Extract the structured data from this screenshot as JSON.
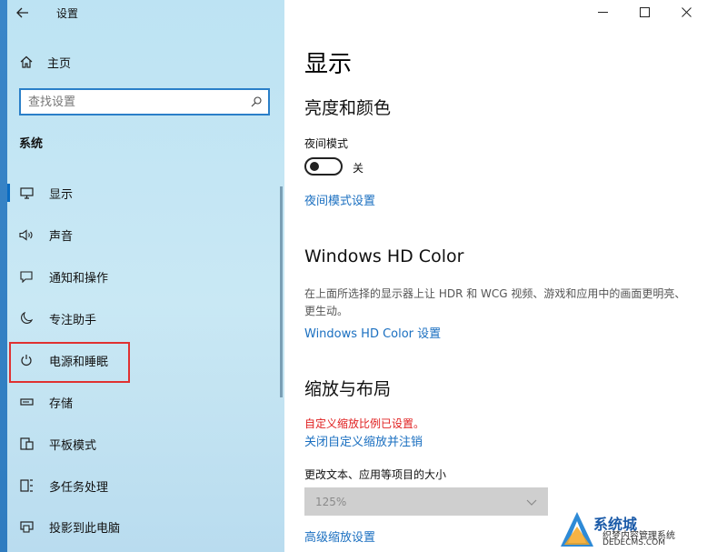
{
  "window": {
    "app_title": "设置",
    "back_icon": "arrow-left-icon",
    "controls": {
      "minimize": "—",
      "maximize": "☐",
      "close": "✕"
    }
  },
  "sidebar": {
    "home_label": "主页",
    "search_placeholder": "查找设置",
    "section_title": "系统",
    "items": [
      {
        "icon": "monitor-icon",
        "label": "显示",
        "active": true
      },
      {
        "icon": "speaker-icon",
        "label": "声音"
      },
      {
        "icon": "notification-icon",
        "label": "通知和操作"
      },
      {
        "icon": "moon-icon",
        "label": "专注助手"
      },
      {
        "icon": "power-icon",
        "label": "电源和睡眠",
        "highlighted": true
      },
      {
        "icon": "storage-icon",
        "label": "存储"
      },
      {
        "icon": "tablet-icon",
        "label": "平板模式"
      },
      {
        "icon": "multitask-icon",
        "label": "多任务处理"
      },
      {
        "icon": "project-icon",
        "label": "投影到此电脑"
      }
    ]
  },
  "main": {
    "page_title": "显示",
    "brightness": {
      "heading": "亮度和颜色",
      "night_mode_label": "夜间模式",
      "night_mode_state": "关",
      "night_mode_link": "夜间模式设置"
    },
    "hdr": {
      "heading": "Windows HD Color",
      "description": "在上面所选择的显示器上让 HDR 和 WCG 视频、游戏和应用中的画面更明亮、更生动。",
      "link": "Windows HD Color 设置"
    },
    "scale": {
      "heading": "缩放与布局",
      "warning": "自定义缩放比例已设置。",
      "link_off": "关闭自定义缩放并注销",
      "size_label": "更改文本、应用等项目的大小",
      "size_value": "125%",
      "advanced_link": "高级缩放设置"
    }
  },
  "watermark": {
    "brand": "系统城",
    "line1": "织梦内容管理系统",
    "line2": "DEDECMS.COM"
  }
}
